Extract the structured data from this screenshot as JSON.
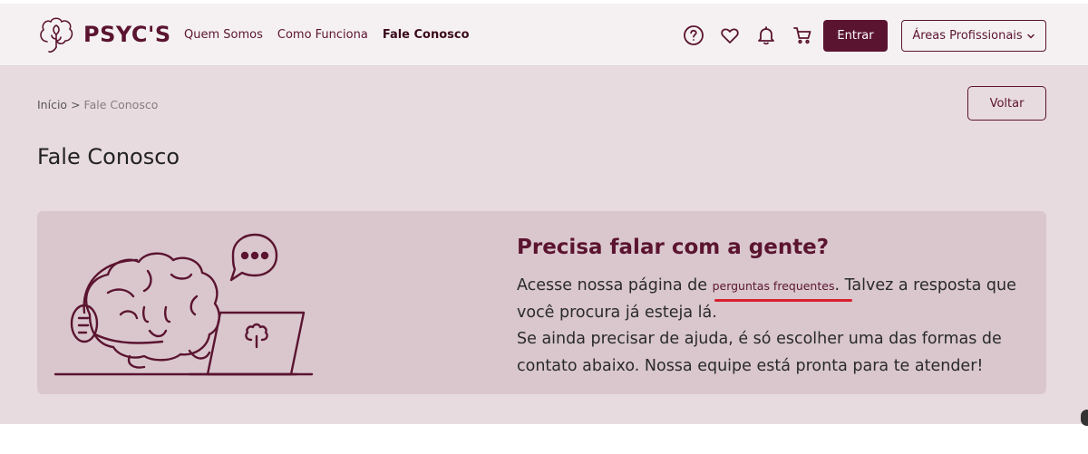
{
  "header": {
    "logo_text": "PSYC'S",
    "nav": [
      "Quem Somos",
      "Como Funciona",
      "Fale Conosco"
    ],
    "icons": [
      "help-icon",
      "heart-icon",
      "bell-icon",
      "cart-icon"
    ],
    "entrar_label": "Entrar",
    "areas_label": "Áreas Profissionais"
  },
  "breadcrumb": {
    "home": "Início",
    "separator": ">",
    "current": "Fale Conosco"
  },
  "voltar_label": "Voltar",
  "page_title": "Fale Conosco",
  "card": {
    "title": "Precisa falar com a gente?",
    "line1_before": "Acesse nossa página de ",
    "faq_link": "perguntas frequentes",
    "line1_after": ". Talvez a resposta que você procura já esteja lá.",
    "line2": "Se ainda precisar de ajuda, é só escolher uma das formas de contato abaixo. Nossa equipe está pronta para te atender!"
  },
  "colors": {
    "brand": "#5b1430",
    "background": "#e8dbdf",
    "card": "#d9c7cd",
    "highlight": "#d91f2f"
  }
}
